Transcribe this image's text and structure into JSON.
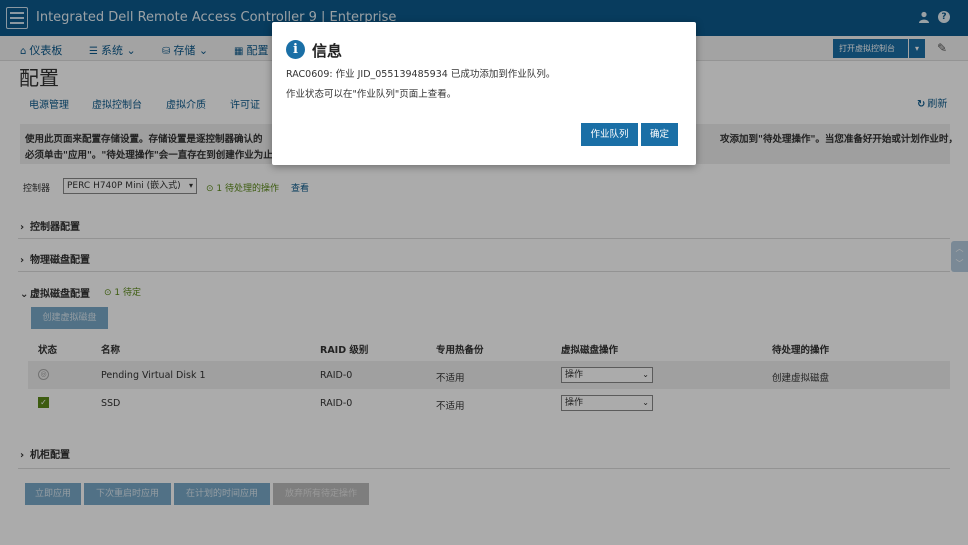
{
  "header": {
    "title": "Integrated Dell Remote Access Controller 9 | Enterprise",
    "logo_icon": "server-icon",
    "user_icon": "user-icon",
    "help_label": "?",
    "bg_color": "#0d5a8c"
  },
  "nav": {
    "items": [
      {
        "label": "仪表板",
        "icon": "home-icon"
      },
      {
        "label": "系统",
        "icon": "list-icon"
      },
      {
        "label": "存储",
        "icon": "database-icon"
      },
      {
        "label": "配置",
        "icon": "grid-icon"
      }
    ],
    "virtual_console_label": "打开虚拟控制台",
    "virtual_console_caret": "▾",
    "pin_icon": "pin-icon"
  },
  "page": {
    "title": "配置",
    "tabs": [
      "电源管理",
      "虚拟控制台",
      "虚拟介质",
      "许可证"
    ],
    "refresh_label": "刷新",
    "refresh_icon": "refresh-icon"
  },
  "info": {
    "line1": "使用此页面来配置存储设置。存储设置是逐控制器确认的",
    "line1_right": "攻添加到\"待处理操作\"。当您准备好开始或计划作业时，",
    "line2": "必须单击\"应用\"。\"待处理操作\"会一直存在到创建作业为止"
  },
  "controller": {
    "label": "控制器",
    "value": "PERC H740P Mini (嵌入式)",
    "pending_text": "1 待处理的操作",
    "view_link": "查看"
  },
  "sections": {
    "controller_config": "控制器配置",
    "physical_disk_config": "物理磁盘配置",
    "virtual_disk_config": "虚拟磁盘配置",
    "virtual_disk_pending": "1 待定",
    "enclosure_config": "机柜配置"
  },
  "vd": {
    "create_button": "创建虚拟磁盘",
    "columns": [
      "状态",
      "名称",
      "RAID 级别",
      "专用热备份",
      "虚拟磁盘操作",
      "待处理的操作"
    ],
    "rows": [
      {
        "status": "pending",
        "name": "Pending Virtual Disk 1",
        "raid": "RAID-0",
        "hotspare": "不适用",
        "action": "操作",
        "pending_action": "创建虚拟磁盘"
      },
      {
        "status": "ok",
        "name": "SSD",
        "raid": "RAID-0",
        "hotspare": "不适用",
        "action": "操作",
        "pending_action": ""
      }
    ]
  },
  "footer_buttons": {
    "apply_now": "立即应用",
    "apply_next_reboot": "下次重启时应用",
    "apply_scheduled": "在计划的时间应用",
    "discard_all": "放弃所有待定操作"
  },
  "dialog": {
    "title": "信息",
    "icon": "info-icon",
    "message1": "RAC0609: 作业 JID_055139485934 已成功添加到作业队列。",
    "message2": "作业状态可以在\"作业队列\"页面上查看。",
    "job_queue_button": "作业队列",
    "ok_button": "确定"
  }
}
